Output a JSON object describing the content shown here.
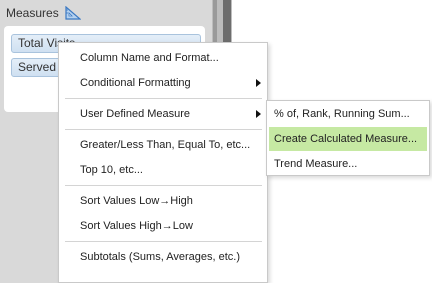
{
  "panel": {
    "title": "Measures",
    "icon": "ruler-triangle-icon",
    "pills": [
      "Total Visits",
      "Served"
    ]
  },
  "menu": {
    "items": [
      {
        "label": "Column Name and Format...",
        "has_submenu": false
      },
      {
        "label": "Conditional Formatting",
        "has_submenu": true
      },
      {
        "label": "User Defined Measure",
        "has_submenu": true
      },
      {
        "label": "Greater/Less Than, Equal To, etc...",
        "has_submenu": false
      },
      {
        "label": "Top 10, etc...",
        "has_submenu": false
      },
      {
        "label": "Sort Values Low→High",
        "has_submenu": false
      },
      {
        "label": "Sort Values High→Low",
        "has_submenu": false
      },
      {
        "label": "Subtotals (Sums, Averages, etc.)",
        "has_submenu": false
      }
    ]
  },
  "submenu": {
    "items": [
      {
        "label": "% of, Rank, Running Sum...",
        "highlighted": false
      },
      {
        "label": "Create Calculated Measure...",
        "highlighted": true
      },
      {
        "label": "Trend Measure...",
        "highlighted": false
      }
    ],
    "highlight_color": "#c6e9a3"
  }
}
